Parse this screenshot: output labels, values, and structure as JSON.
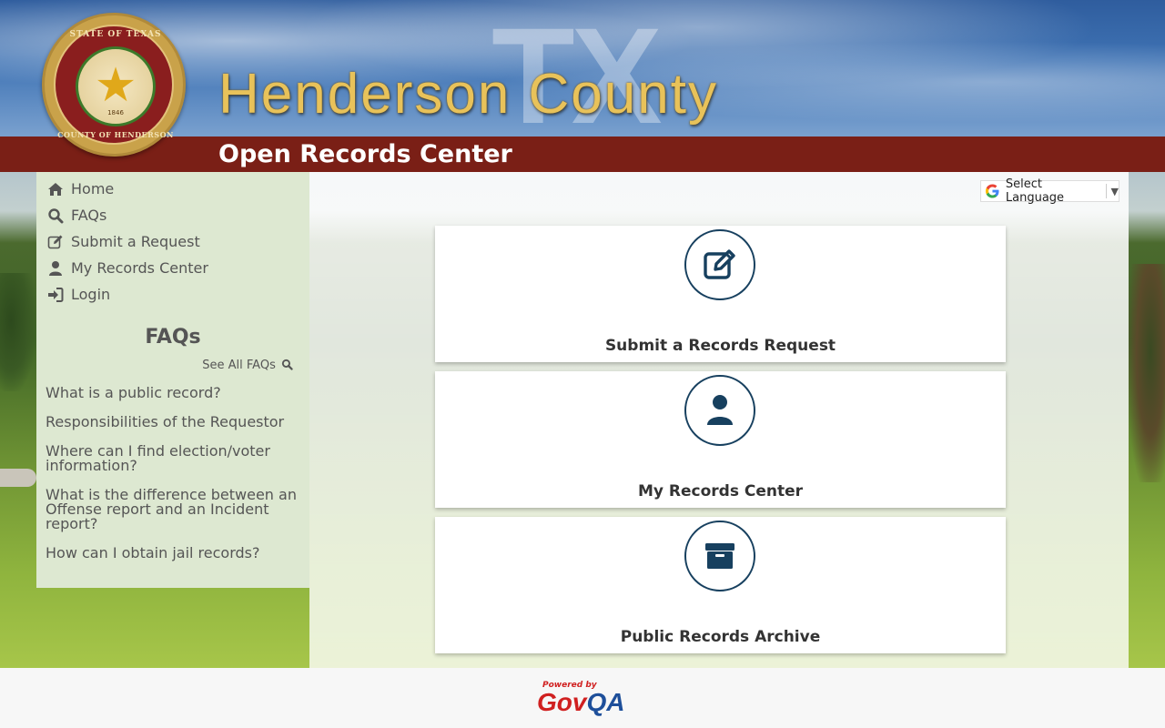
{
  "header": {
    "county_name": "Henderson County",
    "watermark": "TX",
    "title": "Open Records Center",
    "seal": {
      "top_text": "STATE OF TEXAS",
      "bottom_text": "COUNTY OF HENDERSON",
      "year": "1846"
    }
  },
  "nav": {
    "items": [
      {
        "label": "Home",
        "icon": "home-icon"
      },
      {
        "label": "FAQs",
        "icon": "search-icon"
      },
      {
        "label": "Submit a Request",
        "icon": "edit-icon"
      },
      {
        "label": "My Records Center",
        "icon": "user-icon"
      },
      {
        "label": "Login",
        "icon": "sign-in-icon"
      }
    ]
  },
  "faq": {
    "heading": "FAQs",
    "see_all": "See All FAQs",
    "items": [
      "What is a public record?",
      "Responsibilities of the Requestor",
      "Where can I find election/voter information?",
      "What is the difference between an Offense report and an Incident report?",
      "How can I obtain jail records?"
    ]
  },
  "translate": {
    "label": "Select Language"
  },
  "cards": [
    {
      "label": "Submit a Records Request",
      "icon": "edit-icon"
    },
    {
      "label": "My Records Center",
      "icon": "user-icon"
    },
    {
      "label": "Public Records Archive",
      "icon": "archive-icon"
    }
  ],
  "footer": {
    "powered_by": "Powered by",
    "brand_part1": "Gov",
    "brand_part2": "QA"
  },
  "colors": {
    "title_bar": "#7a1f16",
    "sidebar_bg": "#dde8d1",
    "icon_navy": "#17405f",
    "brand_red": "#d02020",
    "brand_blue": "#1e4f9a"
  }
}
